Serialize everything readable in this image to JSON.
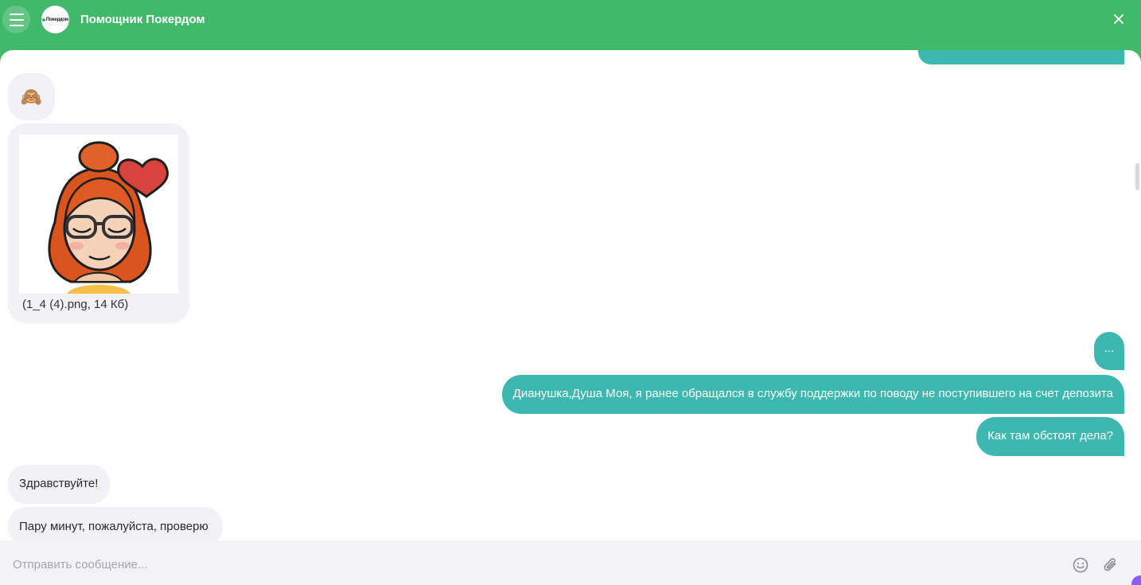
{
  "header": {
    "title": "Помощник Покердом",
    "logo_text": "Покердом",
    "bg_color": "#40b96a"
  },
  "messages": {
    "emoji": "🙈",
    "attachment_caption": "(1_4 (4).png, 14 Кб)",
    "dots": "...",
    "long_message": "Дианушка,Душа Моя, я ранее обращался в службу поддержки по поводу не поступившего на счет депозита",
    "how_message": "Как там обстоят дела?",
    "hello_message": "Здравствуйте!",
    "wait_message": "Пару минут, пожалуйста,  проверю"
  },
  "input": {
    "placeholder": "Отправить сообщение...",
    "value": ""
  },
  "colors": {
    "outgoing_bubble": "#3cb8b0",
    "incoming_bubble": "#f1f1f6"
  },
  "icons": {
    "menu": "hamburger-icon",
    "close": "close-icon",
    "emoji_picker": "smiley-icon",
    "attach": "paperclip-icon"
  }
}
